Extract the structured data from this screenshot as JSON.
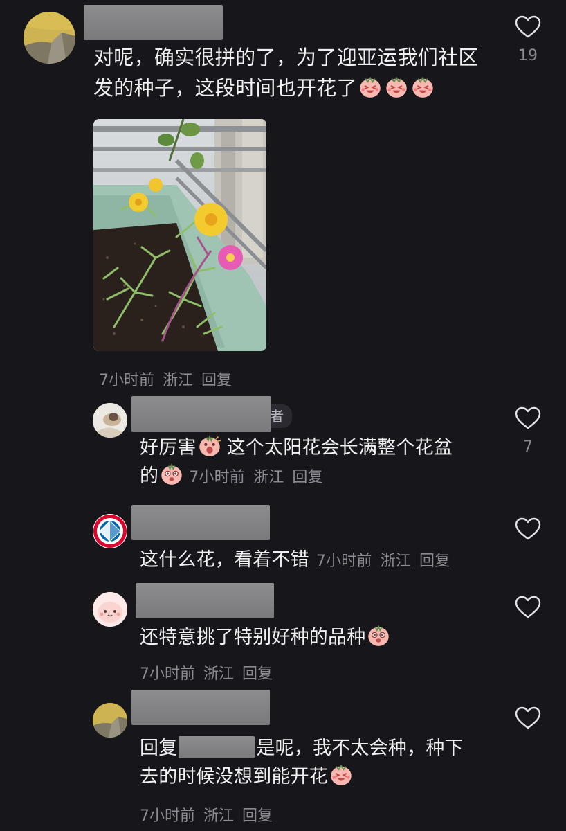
{
  "comments": [
    {
      "text_line1": "对呢，确实很拼的了，为了迎亚运我们社区",
      "text_line2": "发的种子，这段时间也开花了",
      "time": "7小时前",
      "location": "浙江",
      "reply_label": "回复",
      "likes": "19"
    }
  ],
  "replies": [
    {
      "author_tag": "者",
      "text_line1": "好厉害",
      "text_line1b": "这个太阳花会长满整个花盆",
      "text_line2": "的",
      "time": "7小时前",
      "location": "浙江",
      "reply_label": "回复",
      "likes": "7"
    },
    {
      "text": "这什么花，看着不错",
      "time": "7小时前",
      "location": "浙江",
      "reply_label": "回复",
      "likes": ""
    },
    {
      "text": "还特意挑了特别好种的品种",
      "time": "7小时前",
      "location": "浙江",
      "reply_label": "回复",
      "likes": ""
    },
    {
      "reply_prefix": "回复",
      "text_line1": "是呢，我不太会种，种下",
      "text_line2": "去的时候没想到能开花",
      "time": "7小时前",
      "location": "浙江",
      "reply_label": "回复",
      "likes": ""
    }
  ],
  "colors": {
    "background": "#17161b",
    "text": "#f0f0f2",
    "meta": "#8b8a92",
    "redaction": "#838386"
  },
  "icons": {
    "like": "heart-outline-icon"
  }
}
